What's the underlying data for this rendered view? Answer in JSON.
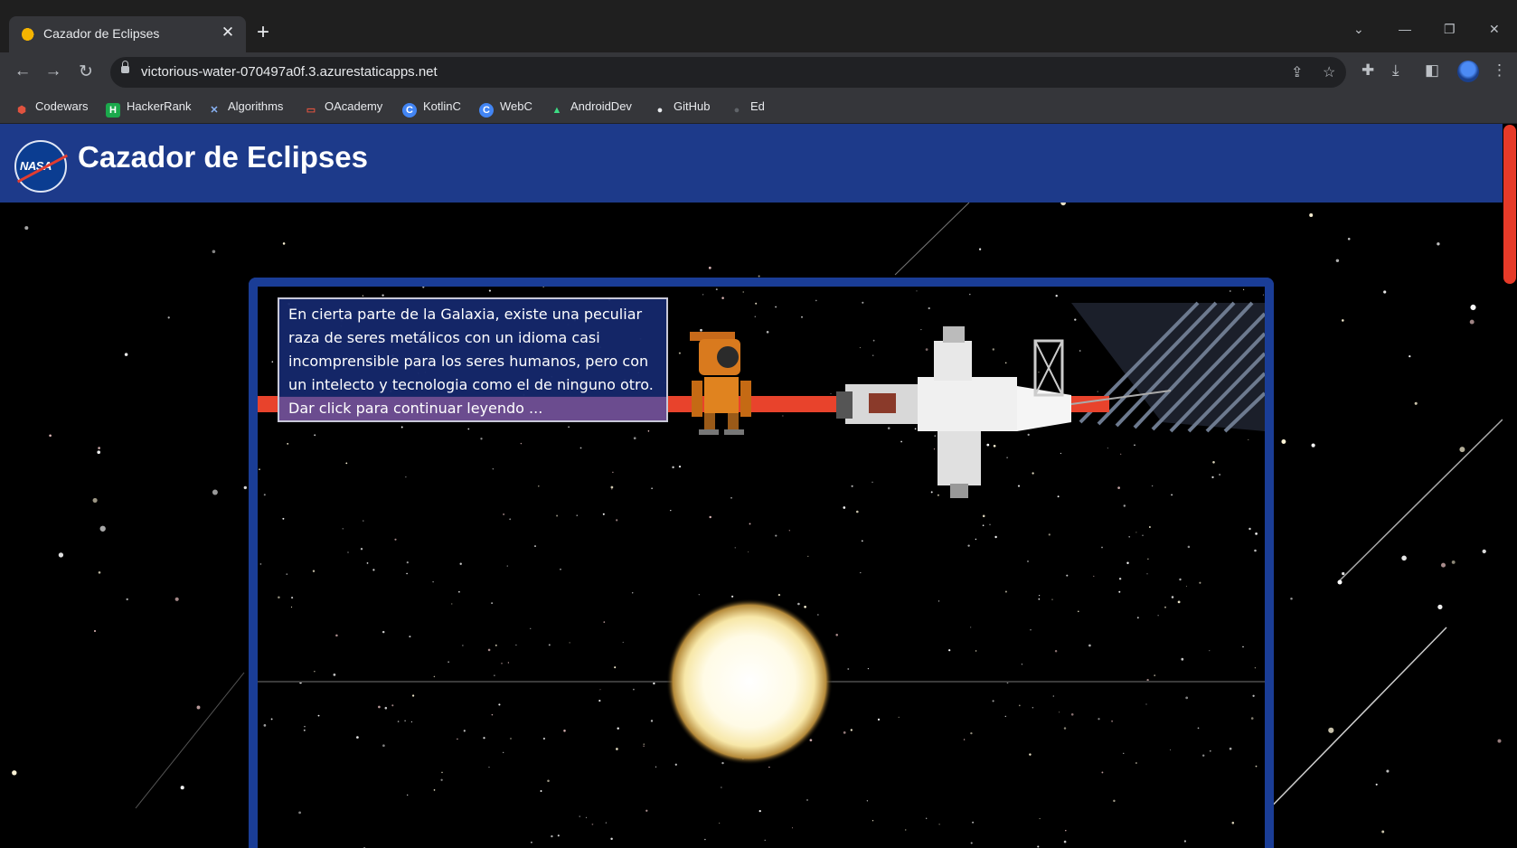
{
  "browser": {
    "tab_title": "Cazador de Eclipses",
    "tab_close": "✕",
    "new_tab": "+",
    "url": "victorious-water-070497a0f.3.azurestaticapps.net",
    "bookmarks": [
      {
        "label": "Codewars",
        "icon": "codewars-icon",
        "color": "#e0533f",
        "glyph": "⬢"
      },
      {
        "label": "HackerRank",
        "icon": "hackerrank-icon",
        "color": "#1ba94c",
        "glyph": "H"
      },
      {
        "label": "Algorithms",
        "icon": "algorithms-icon",
        "color": "#8ab4f8",
        "glyph": "✕"
      },
      {
        "label": "OAcademy",
        "icon": "oracle-icon",
        "color": "#e0533f",
        "glyph": "▭"
      },
      {
        "label": "KotlinC",
        "icon": "kotlinc-icon",
        "color": "#4285f4",
        "glyph": "C"
      },
      {
        "label": "WebC",
        "icon": "webc-icon",
        "color": "#4285f4",
        "glyph": "C"
      },
      {
        "label": "AndroidDev",
        "icon": "android-icon",
        "color": "#3ddc84",
        "glyph": "▲"
      },
      {
        "label": "GitHub",
        "icon": "github-icon",
        "color": "#e8eaed",
        "glyph": "●"
      },
      {
        "label": "Ed",
        "icon": "ed-icon",
        "color": "#5f6368",
        "glyph": "●"
      }
    ]
  },
  "site": {
    "logo_text": "NASA",
    "title": "Cazador de Eclipses"
  },
  "game": {
    "dialog_text": "En cierta parte de la Galaxia, existe una peculiar raza de seres metálicos con un idioma casi incomprensible para los seres humanos, pero con un intelecto y tecnologia como el de ninguno otro.",
    "continue_text": "Dar click para continuar leyendo ..."
  },
  "colors": {
    "header": "#1d3a8a",
    "frame": "#1a3d96",
    "laser": "#e8432c",
    "dialog_bg": "#15286b",
    "continue_bg": "#6b4c8f"
  }
}
